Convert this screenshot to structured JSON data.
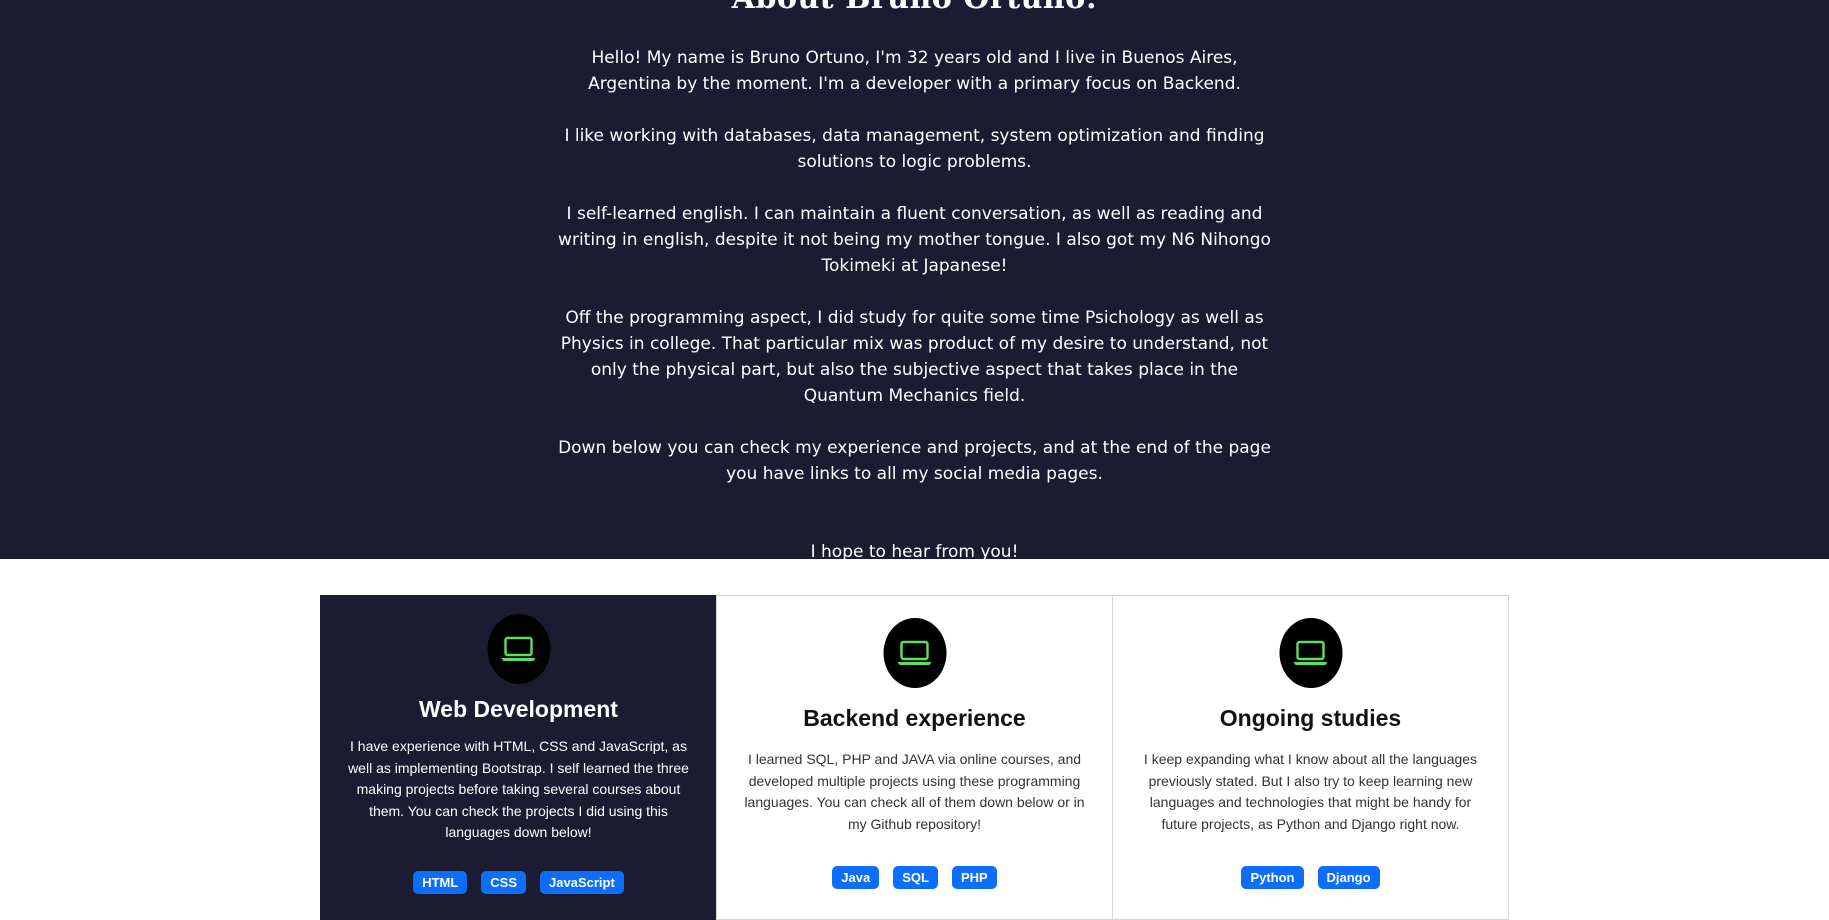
{
  "about": {
    "title": "About Bruno Ortuno:",
    "paragraphs": [
      "Hello! My name is Bruno Ortuno, I'm 32 years old and I live in Buenos Aires, Argentina by the moment. I'm a developer with a primary focus on Backend.",
      "I like working with databases, data management, system optimization and finding solutions to logic problems.",
      "I self-learned english. I can maintain a fluent conversation, as well as reading and writing in english, despite it not being my mother tongue. I also got my N6 Nihongo Tokimeki at Japanese!",
      "Off the programming aspect, I did study for quite some time Psichology as well as Physics in college. That particular mix was product of my desire to understand, not only the physical part, but also the subjective aspect that takes place in the Quantum Mechanics field.",
      "Down below you can check my experience and projects, and at the end of the page you have links to all my social media pages."
    ],
    "closing": "I hope to hear from you!"
  },
  "cards": [
    {
      "icon": "laptop-icon",
      "title": "Web Development",
      "text": "I have experience with HTML, CSS and JavaScript, as well as implementing Bootstrap. I self learned the three making projects before taking several courses about them. You can check the projects I did using this languages down below!",
      "badges": [
        "HTML",
        "CSS",
        "JavaScript"
      ]
    },
    {
      "icon": "laptop-icon",
      "title": "Backend experience",
      "text": "I learned SQL, PHP and JAVA via online courses, and developed multiple projects using these programming languages. You can check all of them down below or in my Github repository!",
      "badges": [
        "Java",
        "SQL",
        "PHP"
      ]
    },
    {
      "icon": "laptop-icon",
      "title": "Ongoing studies",
      "text": "I keep expanding what I know about all the languages previously stated. But I also try to keep learning new languages and technologies that might be handy for future projects, as Python and Django right now.",
      "badges": [
        "Python",
        "Django"
      ]
    }
  ],
  "colors": {
    "dark_bg": "#1b1b32",
    "icon_green": "#5ee05e",
    "badge_blue": "#0d6efd"
  }
}
